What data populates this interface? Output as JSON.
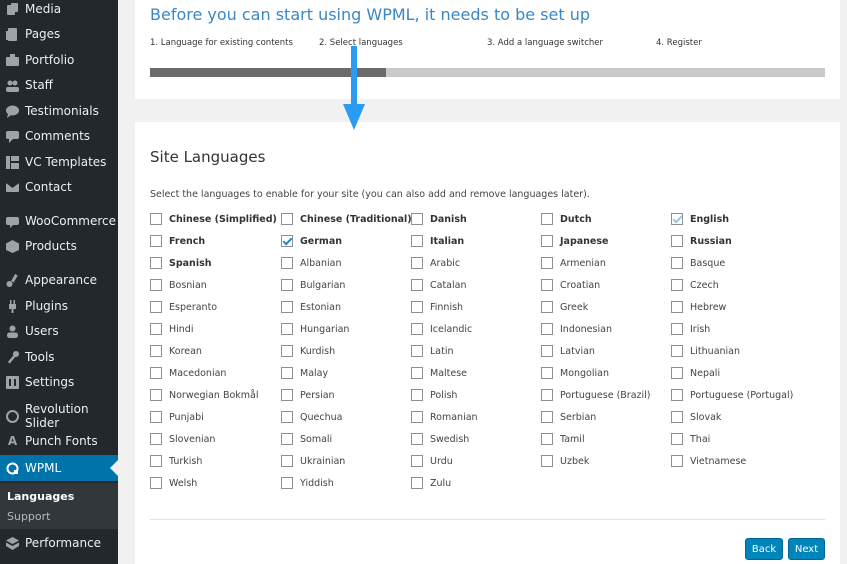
{
  "sidebar": {
    "items": [
      {
        "label": "Media",
        "icon": "media-icon"
      },
      {
        "label": "Pages",
        "icon": "pages-icon"
      },
      {
        "label": "Portfolio",
        "icon": "portfolio-icon"
      },
      {
        "label": "Staff",
        "icon": "staff-icon"
      },
      {
        "label": "Testimonials",
        "icon": "speech-bubble-icon"
      },
      {
        "label": "Comments",
        "icon": "comment-icon"
      },
      {
        "label": "VC Templates",
        "icon": "vc-templates-icon"
      },
      {
        "label": "Contact",
        "icon": "envelope-icon"
      },
      {
        "label": "WooCommerce",
        "icon": "woocommerce-icon"
      },
      {
        "label": "Products",
        "icon": "products-icon"
      },
      {
        "label": "Appearance",
        "icon": "brush-icon"
      },
      {
        "label": "Plugins",
        "icon": "plugin-icon"
      },
      {
        "label": "Users",
        "icon": "users-icon"
      },
      {
        "label": "Tools",
        "icon": "wrench-icon"
      },
      {
        "label": "Settings",
        "icon": "settings-icon"
      },
      {
        "label": "Revolution Slider",
        "icon": "refresh-icon"
      },
      {
        "label": "Punch Fonts",
        "icon": "font-icon",
        "icon_text": "A"
      },
      {
        "label": "WPML",
        "icon": "wpml-icon",
        "active": true
      },
      {
        "label": "Performance",
        "icon": "performance-icon"
      }
    ],
    "submenu": [
      {
        "label": "Languages",
        "current": true
      },
      {
        "label": "Support",
        "current": false
      }
    ]
  },
  "setup": {
    "title": "Before you can start using WPML, it needs to be set up",
    "steps": [
      "1. Language for existing contents",
      "2. Select languages",
      "3. Add a language switcher",
      "4. Register"
    ],
    "progress": 0.35
  },
  "site_languages": {
    "title": "Site Languages",
    "description": "Select the languages to enable for your site (you can also add and remove languages later).",
    "columns": [
      [
        {
          "name": "Chinese (Simplified)",
          "checked": false,
          "bold": true
        },
        {
          "name": "French",
          "checked": false,
          "bold": true
        },
        {
          "name": "Spanish",
          "checked": false,
          "bold": true
        },
        {
          "name": "Bosnian",
          "checked": false,
          "bold": false
        },
        {
          "name": "Esperanto",
          "checked": false,
          "bold": false
        },
        {
          "name": "Hindi",
          "checked": false,
          "bold": false
        },
        {
          "name": "Korean",
          "checked": false,
          "bold": false
        },
        {
          "name": "Macedonian",
          "checked": false,
          "bold": false
        },
        {
          "name": "Norwegian Bokmål",
          "checked": false,
          "bold": false
        },
        {
          "name": "Punjabi",
          "checked": false,
          "bold": false
        },
        {
          "name": "Slovenian",
          "checked": false,
          "bold": false
        },
        {
          "name": "Turkish",
          "checked": false,
          "bold": false
        },
        {
          "name": "Welsh",
          "checked": false,
          "bold": false
        }
      ],
      [
        {
          "name": "Chinese (Traditional)",
          "checked": false,
          "bold": true
        },
        {
          "name": "German",
          "checked": true,
          "bold": true
        },
        {
          "name": "Albanian",
          "checked": false,
          "bold": false
        },
        {
          "name": "Bulgarian",
          "checked": false,
          "bold": false
        },
        {
          "name": "Estonian",
          "checked": false,
          "bold": false
        },
        {
          "name": "Hungarian",
          "checked": false,
          "bold": false
        },
        {
          "name": "Kurdish",
          "checked": false,
          "bold": false
        },
        {
          "name": "Malay",
          "checked": false,
          "bold": false
        },
        {
          "name": "Persian",
          "checked": false,
          "bold": false
        },
        {
          "name": "Quechua",
          "checked": false,
          "bold": false
        },
        {
          "name": "Somali",
          "checked": false,
          "bold": false
        },
        {
          "name": "Ukrainian",
          "checked": false,
          "bold": false
        },
        {
          "name": "Yiddish",
          "checked": false,
          "bold": false
        }
      ],
      [
        {
          "name": "Danish",
          "checked": false,
          "bold": true
        },
        {
          "name": "Italian",
          "checked": false,
          "bold": true
        },
        {
          "name": "Arabic",
          "checked": false,
          "bold": false
        },
        {
          "name": "Catalan",
          "checked": false,
          "bold": false
        },
        {
          "name": "Finnish",
          "checked": false,
          "bold": false
        },
        {
          "name": "Icelandic",
          "checked": false,
          "bold": false
        },
        {
          "name": "Latin",
          "checked": false,
          "bold": false
        },
        {
          "name": "Maltese",
          "checked": false,
          "bold": false
        },
        {
          "name": "Polish",
          "checked": false,
          "bold": false
        },
        {
          "name": "Romanian",
          "checked": false,
          "bold": false
        },
        {
          "name": "Swedish",
          "checked": false,
          "bold": false
        },
        {
          "name": "Urdu",
          "checked": false,
          "bold": false
        },
        {
          "name": "Zulu",
          "checked": false,
          "bold": false
        }
      ],
      [
        {
          "name": "Dutch",
          "checked": false,
          "bold": true
        },
        {
          "name": "Japanese",
          "checked": false,
          "bold": true
        },
        {
          "name": "Armenian",
          "checked": false,
          "bold": false
        },
        {
          "name": "Croatian",
          "checked": false,
          "bold": false
        },
        {
          "name": "Greek",
          "checked": false,
          "bold": false
        },
        {
          "name": "Indonesian",
          "checked": false,
          "bold": false
        },
        {
          "name": "Latvian",
          "checked": false,
          "bold": false
        },
        {
          "name": "Mongolian",
          "checked": false,
          "bold": false
        },
        {
          "name": "Portuguese (Brazil)",
          "checked": false,
          "bold": false
        },
        {
          "name": "Serbian",
          "checked": false,
          "bold": false
        },
        {
          "name": "Tamil",
          "checked": false,
          "bold": false
        },
        {
          "name": "Uzbek",
          "checked": false,
          "bold": false
        }
      ],
      [
        {
          "name": "English",
          "checked": true,
          "bold": true,
          "faint": true
        },
        {
          "name": "Russian",
          "checked": false,
          "bold": true
        },
        {
          "name": "Basque",
          "checked": false,
          "bold": false
        },
        {
          "name": "Czech",
          "checked": false,
          "bold": false
        },
        {
          "name": "Hebrew",
          "checked": false,
          "bold": false
        },
        {
          "name": "Irish",
          "checked": false,
          "bold": false
        },
        {
          "name": "Lithuanian",
          "checked": false,
          "bold": false
        },
        {
          "name": "Nepali",
          "checked": false,
          "bold": false
        },
        {
          "name": "Portuguese (Portugal)",
          "checked": false,
          "bold": false
        },
        {
          "name": "Slovak",
          "checked": false,
          "bold": false
        },
        {
          "name": "Thai",
          "checked": false,
          "bold": false
        },
        {
          "name": "Vietnamese",
          "checked": false,
          "bold": false
        }
      ]
    ]
  },
  "buttons": {
    "back": "Back",
    "next": "Next"
  },
  "colors": {
    "accent": "#0073aa",
    "button": "#0085ba",
    "title": "#3a87c5",
    "arrow": "#2b9af3"
  }
}
